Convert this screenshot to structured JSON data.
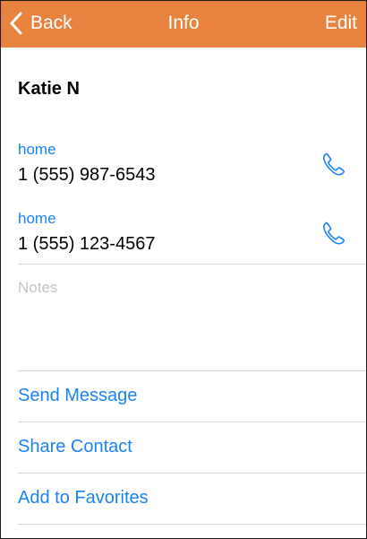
{
  "navbar": {
    "back_label": "Back",
    "title": "Info",
    "edit_label": "Edit",
    "color": "#e8823f"
  },
  "contact": {
    "name": "Katie N"
  },
  "phones": [
    {
      "label": "home",
      "number": "1 (555) 987-6543",
      "icon": "phone-icon"
    },
    {
      "label": "home",
      "number": "1 (555) 123-4567",
      "icon": "phone-icon"
    }
  ],
  "notes": {
    "placeholder": "Notes"
  },
  "actions": [
    {
      "label": "Send Message"
    },
    {
      "label": "Share Contact"
    },
    {
      "label": "Add to Favorites"
    }
  ],
  "colors": {
    "accent": "#1a82f7",
    "navbar": "#e8823f"
  }
}
